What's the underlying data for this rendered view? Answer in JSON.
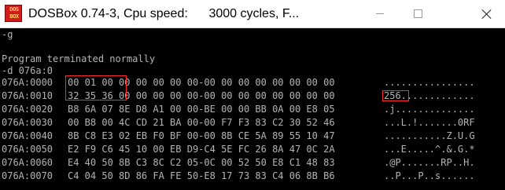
{
  "window": {
    "title": "DOSBox 0.74-3, Cpu speed:      3000 cycles, F...",
    "icon_text": [
      "DOS",
      "BOX"
    ],
    "buttons": [
      "minimize-icon",
      "maximize-icon",
      "close-icon"
    ]
  },
  "console": {
    "colors": {
      "background": "#000000",
      "text": "#b4b4b4",
      "highlight": "#ff2a2a"
    },
    "cmd_g": "-g",
    "blank": "",
    "program_message": "Program terminated normally",
    "cmd_d": "-d 076a:0",
    "dump": [
      {
        "addr": "076A:0000",
        "hex": "00 01 00 00 00 00 00 00-00 00 00 00 00 00 00 00",
        "ascii": "................"
      },
      {
        "addr": "076A:0010",
        "hex": "32 35 36 00 00 00 00 00-00 00 00 00 00 00 00 00",
        "ascii": "256............."
      },
      {
        "addr": "076A:0020",
        "hex": "B8 6A 07 8E D8 A1 00 00-BE 00 00 BB 0A 00 E8 05",
        "ascii": ".j.............."
      },
      {
        "addr": "076A:0030",
        "hex": "00 B8 00 4C CD 21 BA 00-00 F7 F3 83 C2 30 52 46",
        "ascii": "...L.!.......0RF"
      },
      {
        "addr": "076A:0040",
        "hex": "8B C8 E3 02 EB F0 BF 00-00 8B CE 5A 89 55 10 47",
        "ascii": "...........Z.U.G"
      },
      {
        "addr": "076A:0050",
        "hex": "E2 F9 C6 45 10 00 EB D9-C4 5E FC 26 8A 47 0C 2A",
        "ascii": "...E.....^.&.G.*"
      },
      {
        "addr": "076A:0060",
        "hex": "E4 40 50 8B C3 8C C2 05-0C 00 52 50 E8 C1 48 83",
        "ascii": ".@P.......RP..H."
      },
      {
        "addr": "076A:0070",
        "hex": "C4 04 50 8D 86 FA FE 50-E8 17 73 83 C4 06 8B B6",
        "ascii": "..P...P..s......"
      }
    ]
  }
}
